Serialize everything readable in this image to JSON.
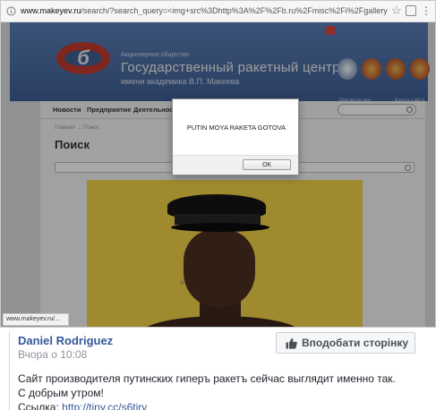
{
  "browser": {
    "url_domain": "www.makeyev.ru",
    "url_path": "/search/?search_query=<img+src%3Dhttp%3A%2F%2Fb.ru%2Fmisc%2Fi%2Fgallery%2F8885%2F216919I...",
    "status_url": "www.makeyev.ru/..."
  },
  "site": {
    "subtitle": "Акционерное общество",
    "title": "Государственный ракетный центр",
    "name_line": "имени академика В.П. Макеева",
    "header_links": [
      "Руководство",
      "Карта сайта"
    ],
    "nav": [
      "Новости",
      "Предприятие",
      "Деятельность"
    ],
    "breadcrumb": "Главная → Поиск",
    "page_heading": "Поиск"
  },
  "alert": {
    "message": "PUTIN MOYA RAKETA GOTOVA",
    "ok_label": "OK"
  },
  "post": {
    "author": "Daniel Rodriguez",
    "time": "Вчора о 10:08",
    "like_page_label": "Вподобати сторінку",
    "line1": "Сайт производителя путинских гиперъ ракетъ сейчас выглядит именно так.",
    "line2": "С добрым утром!",
    "line3_prefix": "Ссылка: ",
    "link": "http://tiny.cc/s6tiry"
  },
  "colors": {
    "fb_link": "#365899",
    "site_header": "#4b6fa6",
    "photo_bg": "#f2d24a"
  }
}
